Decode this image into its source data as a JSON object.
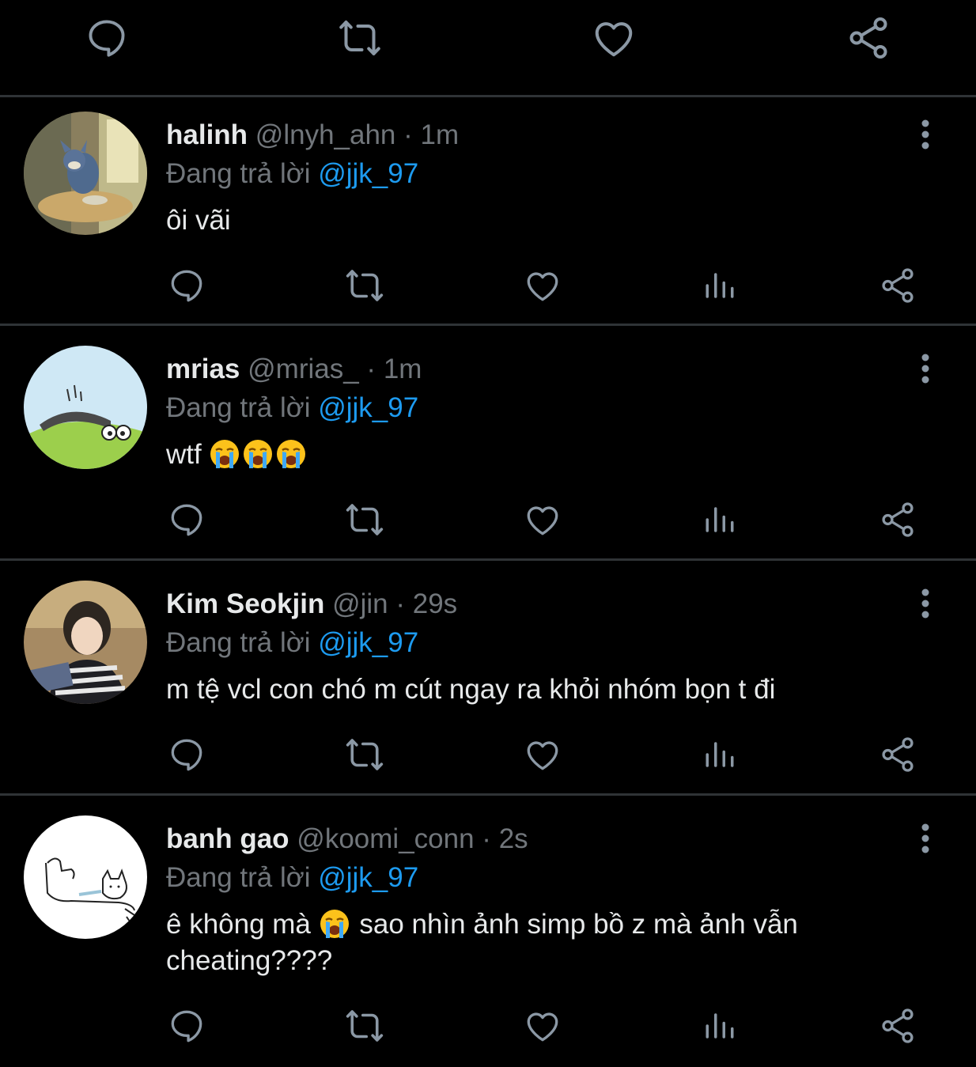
{
  "top_actions": [
    {
      "icon": "reply-icon"
    },
    {
      "icon": "retweet-icon"
    },
    {
      "icon": "like-icon"
    },
    {
      "icon": "share-icon"
    }
  ],
  "tweets": [
    {
      "name": "halinh",
      "handle": "@lnyh_ahn",
      "time": "1m",
      "reply_prefix": "Đang trả lời",
      "reply_to": "@jjk_97",
      "text": "ôi vãi",
      "emoji_after": 0
    },
    {
      "name": "mrias",
      "handle": "@mrias_",
      "time": "1m",
      "reply_prefix": "Đang trả lời",
      "reply_to": "@jjk_97",
      "text": "wtf",
      "emoji_after": 3
    },
    {
      "name": "Kim Seokjin",
      "handle": "@jin",
      "time": "29s",
      "reply_prefix": "Đang trả lời",
      "reply_to": "@jjk_97",
      "text": "m tệ vcl con chó m cút ngay ra khỏi nhóm bọn t đi",
      "emoji_after": 0
    },
    {
      "name": "banh gao",
      "handle": "@koomi_conn",
      "time": "2s",
      "reply_prefix": "Đang trả lời",
      "reply_to": "@jjk_97",
      "text_before": "ê không mà",
      "text_after": "sao nhìn ảnh simp bồ z mà ảnh vẫn cheating????",
      "emoji_inline": 1
    }
  ],
  "colors": {
    "background": "#000000",
    "text_primary": "#e7e9ea",
    "text_secondary": "#71767b",
    "icon": "#8b98a5",
    "link": "#1d9bf0",
    "divider": "#2f3336"
  }
}
